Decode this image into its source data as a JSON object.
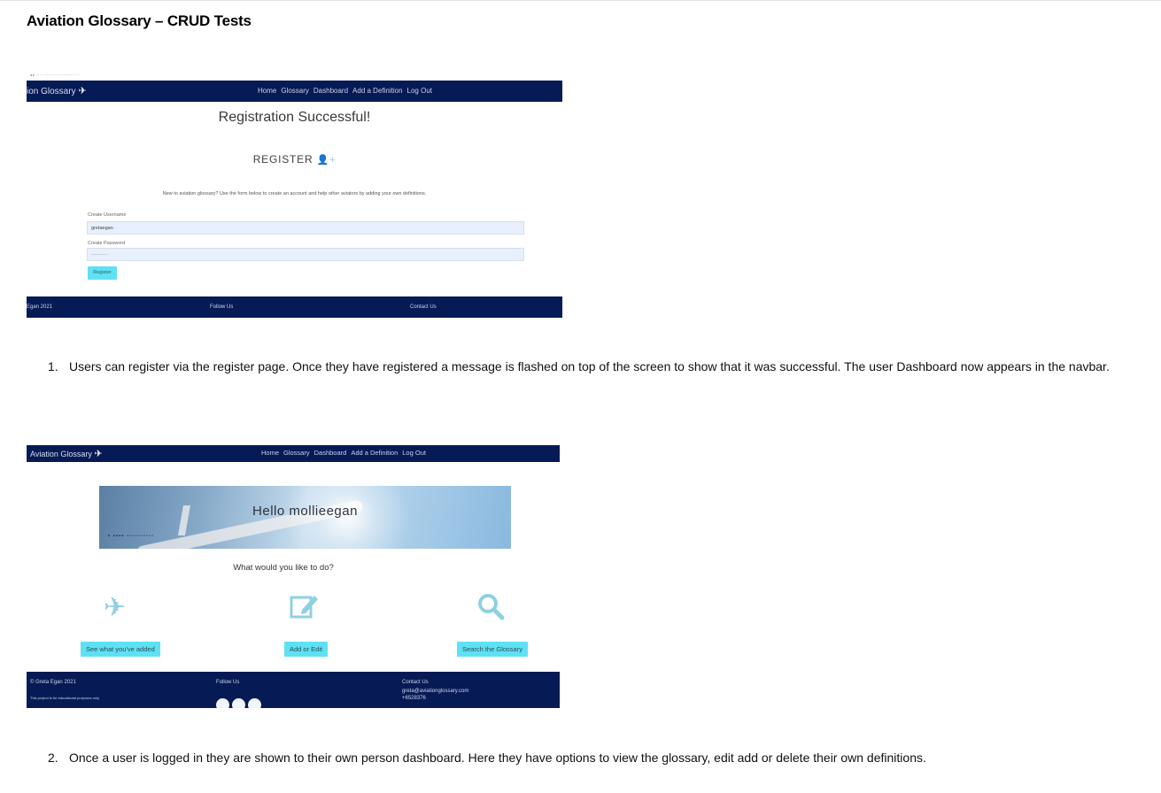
{
  "doc": {
    "title": "Aviation Glossary – CRUD Tests"
  },
  "shot1": {
    "brand": "ion Glossary",
    "nav": [
      "Home",
      "Glossary",
      "Dashboard",
      "Add a Definition",
      "Log Out"
    ],
    "flash": "Registration Successful!",
    "heading": "REGISTER",
    "intro": "New to aviation glossary? Use the form below to create an account and help other aviators by adding your own definitions.",
    "username_label": "Create Username",
    "username_value": "gretaegan",
    "password_label": "Create Password",
    "password_value": "··········",
    "register_button": "Register",
    "footer": {
      "copyright": "Egan 2021",
      "follow": "Follow Us",
      "contact": "Contact Us"
    }
  },
  "captions": [
    {
      "num": "1.",
      "text": "Users can register via the register page. Once they have registered a message is flashed on top of the screen to show that it was successful. The user Dashboard now appears in the navbar."
    },
    {
      "num": "2.",
      "text": "Once a user is logged in they are shown to their own person dashboard. Here they have options to view the glossary, edit add or delete their own definitions."
    }
  ],
  "shot2": {
    "brand": "Aviation Glossary",
    "nav": [
      "Home",
      "Glossary",
      "Dashboard",
      "Add a Definition",
      "Log Out"
    ],
    "hero": "Hello mollieegan",
    "prompt": "What would you like to do?",
    "actions": [
      {
        "icon": "plane-icon",
        "label": "See what you've added"
      },
      {
        "icon": "edit-icon",
        "label": "Add or Edit"
      },
      {
        "icon": "search-icon",
        "label": "Search the Glossary"
      }
    ],
    "footer": {
      "copyright": "© Greta Egan 2021",
      "disclaimer": "This project is for educational purposes only",
      "follow": "Follow Us",
      "contact": "Contact Us",
      "email": "greta@aviationglossary.com",
      "phone": "+6528376"
    }
  }
}
